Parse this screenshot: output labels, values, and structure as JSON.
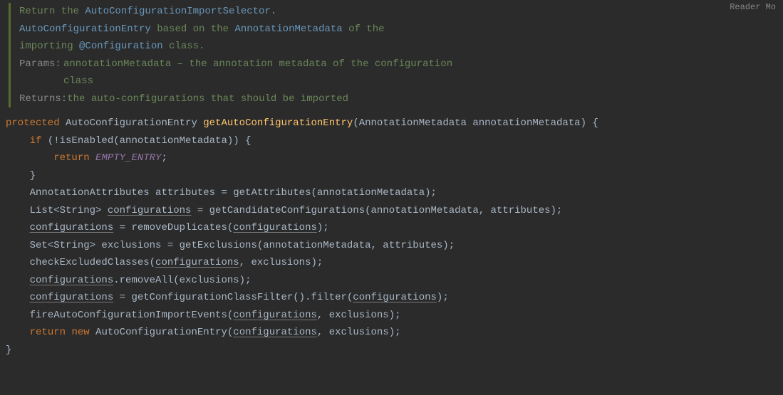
{
  "readerMode": "Reader Mo",
  "javadoc": {
    "line1_t1": "Return the ",
    "line1_link1": "AutoConfigurationImportSelector.",
    "line2_link1": "AutoConfigurationEntry",
    "line2_t1": " based on the ",
    "line2_link2": "AnnotationMetadata",
    "line2_t2": " of the",
    "line3_t1": "importing ",
    "line3_link1": "@Configuration",
    "line3_t2": " class.",
    "paramsLabel": "Params:",
    "paramsLine1": "annotationMetadata – the annotation metadata of the configuration",
    "paramsLine2": "class",
    "returnsLabel": "Returns:",
    "returnsText": "the auto-configurations that should be imported"
  },
  "code": {
    "sig_kw": "protected",
    "sig_type": " AutoConfigurationEntry ",
    "sig_method": "getAutoConfigurationEntry",
    "sig_paren_open": "(",
    "sig_param": "AnnotationMetadata annotationMetadata",
    "sig_paren_close": ") {",
    "if_kw": "if",
    "if_cond": " (!isEnabled(annotationMetadata)) {",
    "ret_kw": "return",
    "ret_sp": " ",
    "ret_const": "EMPTY_ENTRY",
    "ret_semi": ";",
    "if_close": "}",
    "l1": "AnnotationAttributes attributes = getAttributes(annotationMetadata);",
    "l2_a": "List<String> ",
    "l2_u": "configurations",
    "l2_b": " = getCandidateConfigurations(annotationMetadata, attributes);",
    "l3_u1": "configurations",
    "l3_a": " = removeDuplicates(",
    "l3_u2": "configurations",
    "l3_b": ");",
    "l4": "Set<String> exclusions = getExclusions(annotationMetadata, attributes);",
    "l5_a": "checkExcludedClasses(",
    "l5_u": "configurations",
    "l5_b": ", exclusions);",
    "l6_u": "configurations",
    "l6_a": ".removeAll(exclusions);",
    "l7_u1": "configurations",
    "l7_a": " = getConfigurationClassFilter().filter(",
    "l7_u2": "configurations",
    "l7_b": ");",
    "l8_a": "fireAutoConfigurationImportEvents(",
    "l8_u": "configurations",
    "l8_b": ", exclusions);",
    "l9_kw1": "return",
    "l9_sp": " ",
    "l9_kw2": "new",
    "l9_a": " AutoConfigurationEntry(",
    "l9_u": "configurations",
    "l9_b": ", exclusions);",
    "close": "}"
  }
}
